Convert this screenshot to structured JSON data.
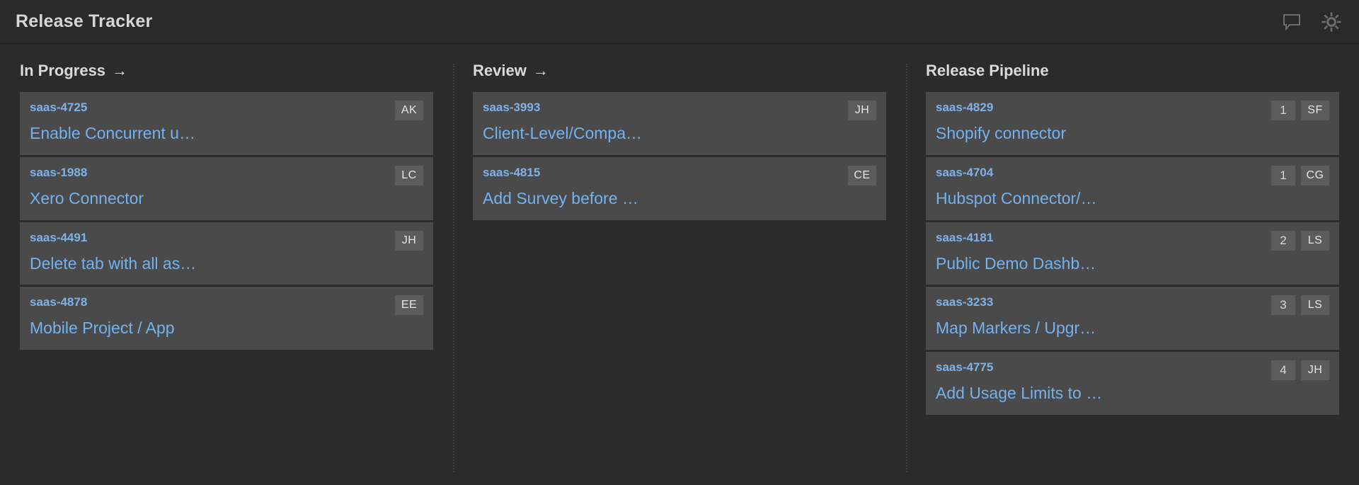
{
  "header": {
    "title": "Release Tracker",
    "icons": [
      {
        "name": "comment-icon",
        "label": "Comments"
      },
      {
        "name": "gear-icon",
        "label": "Settings"
      }
    ]
  },
  "colors": {
    "app_background": "#2b2b2b",
    "header_background": "#2a2a2a",
    "card_background": "#4a4a4a",
    "chip_background": "#5c5c5c",
    "link_blue": "#73b2ef",
    "key_blue": "#7fb3e8",
    "heading_text": "#dadada",
    "icon_gray": "#6e6e6e"
  },
  "board": {
    "columns": [
      {
        "title": "In Progress",
        "arrow": "→",
        "has_arrow": true,
        "cards": [
          {
            "key": "saas-4725",
            "title": "Enable Concurrent u…",
            "avatar": "AK",
            "count": null
          },
          {
            "key": "saas-1988",
            "title": "Xero Connector",
            "avatar": "LC",
            "count": null
          },
          {
            "key": "saas-4491",
            "title": "Delete tab with all as…",
            "avatar": "JH",
            "count": null
          },
          {
            "key": "saas-4878",
            "title": "Mobile Project / App",
            "avatar": "EE",
            "count": null
          }
        ]
      },
      {
        "title": "Review",
        "arrow": "→",
        "has_arrow": true,
        "cards": [
          {
            "key": "saas-3993",
            "title": "Client-Level/Compa…",
            "avatar": "JH",
            "count": null
          },
          {
            "key": "saas-4815",
            "title": "Add Survey before …",
            "avatar": "CE",
            "count": null
          }
        ]
      },
      {
        "title": "Release Pipeline",
        "arrow": "",
        "has_arrow": false,
        "cards": [
          {
            "key": "saas-4829",
            "title": "Shopify connector",
            "avatar": "SF",
            "count": "1"
          },
          {
            "key": "saas-4704",
            "title": "Hubspot Connector/…",
            "avatar": "CG",
            "count": "1"
          },
          {
            "key": "saas-4181",
            "title": "Public Demo Dashb…",
            "avatar": "LS",
            "count": "2"
          },
          {
            "key": "saas-3233",
            "title": "Map Markers / Upgr…",
            "avatar": "LS",
            "count": "3"
          },
          {
            "key": "saas-4775",
            "title": "Add Usage Limits to …",
            "avatar": "JH",
            "count": "4"
          }
        ]
      }
    ]
  }
}
